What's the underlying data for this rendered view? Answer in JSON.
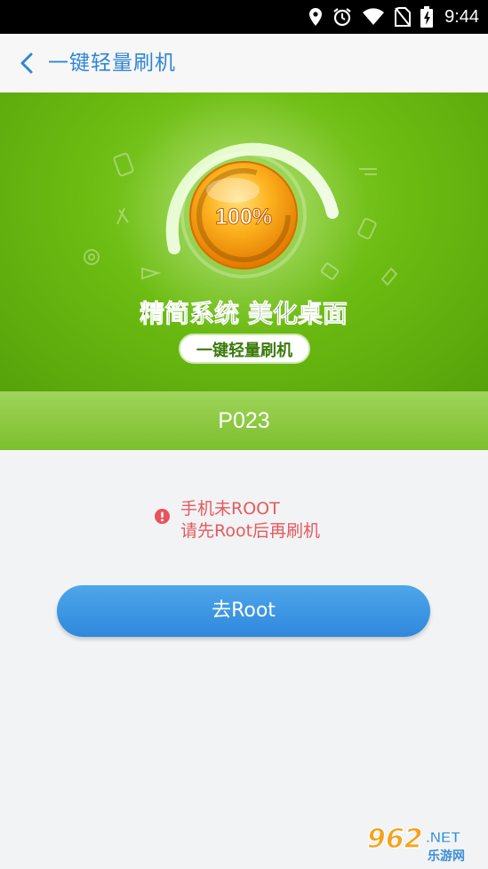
{
  "status_bar": {
    "time": "9:44",
    "icons": [
      "location-icon",
      "alarm-icon",
      "wifi-icon",
      "no-sim-icon",
      "battery-charging-icon"
    ]
  },
  "app_bar": {
    "back_icon": "chevron-left-icon",
    "title": "一键轻量刷机"
  },
  "banner": {
    "percent": "100%",
    "slogan": "精简系统 美化桌面",
    "pill_text": "一键轻量刷机",
    "progress": 1.0,
    "colors": {
      "bg": "#6cbc12",
      "slogan": "#2e6b00",
      "orb": "#f49a00"
    }
  },
  "device": {
    "model": "P023"
  },
  "warning": {
    "icon": "alert-circle-icon",
    "line1": "手机未ROOT",
    "line2": "请先Root后再刷机",
    "color": "#e45a5f"
  },
  "action": {
    "button_label": "去Root",
    "color": "#3a95e3"
  },
  "watermark": {
    "number": "962",
    "suffix": ".NET",
    "tagline": "乐游网"
  }
}
